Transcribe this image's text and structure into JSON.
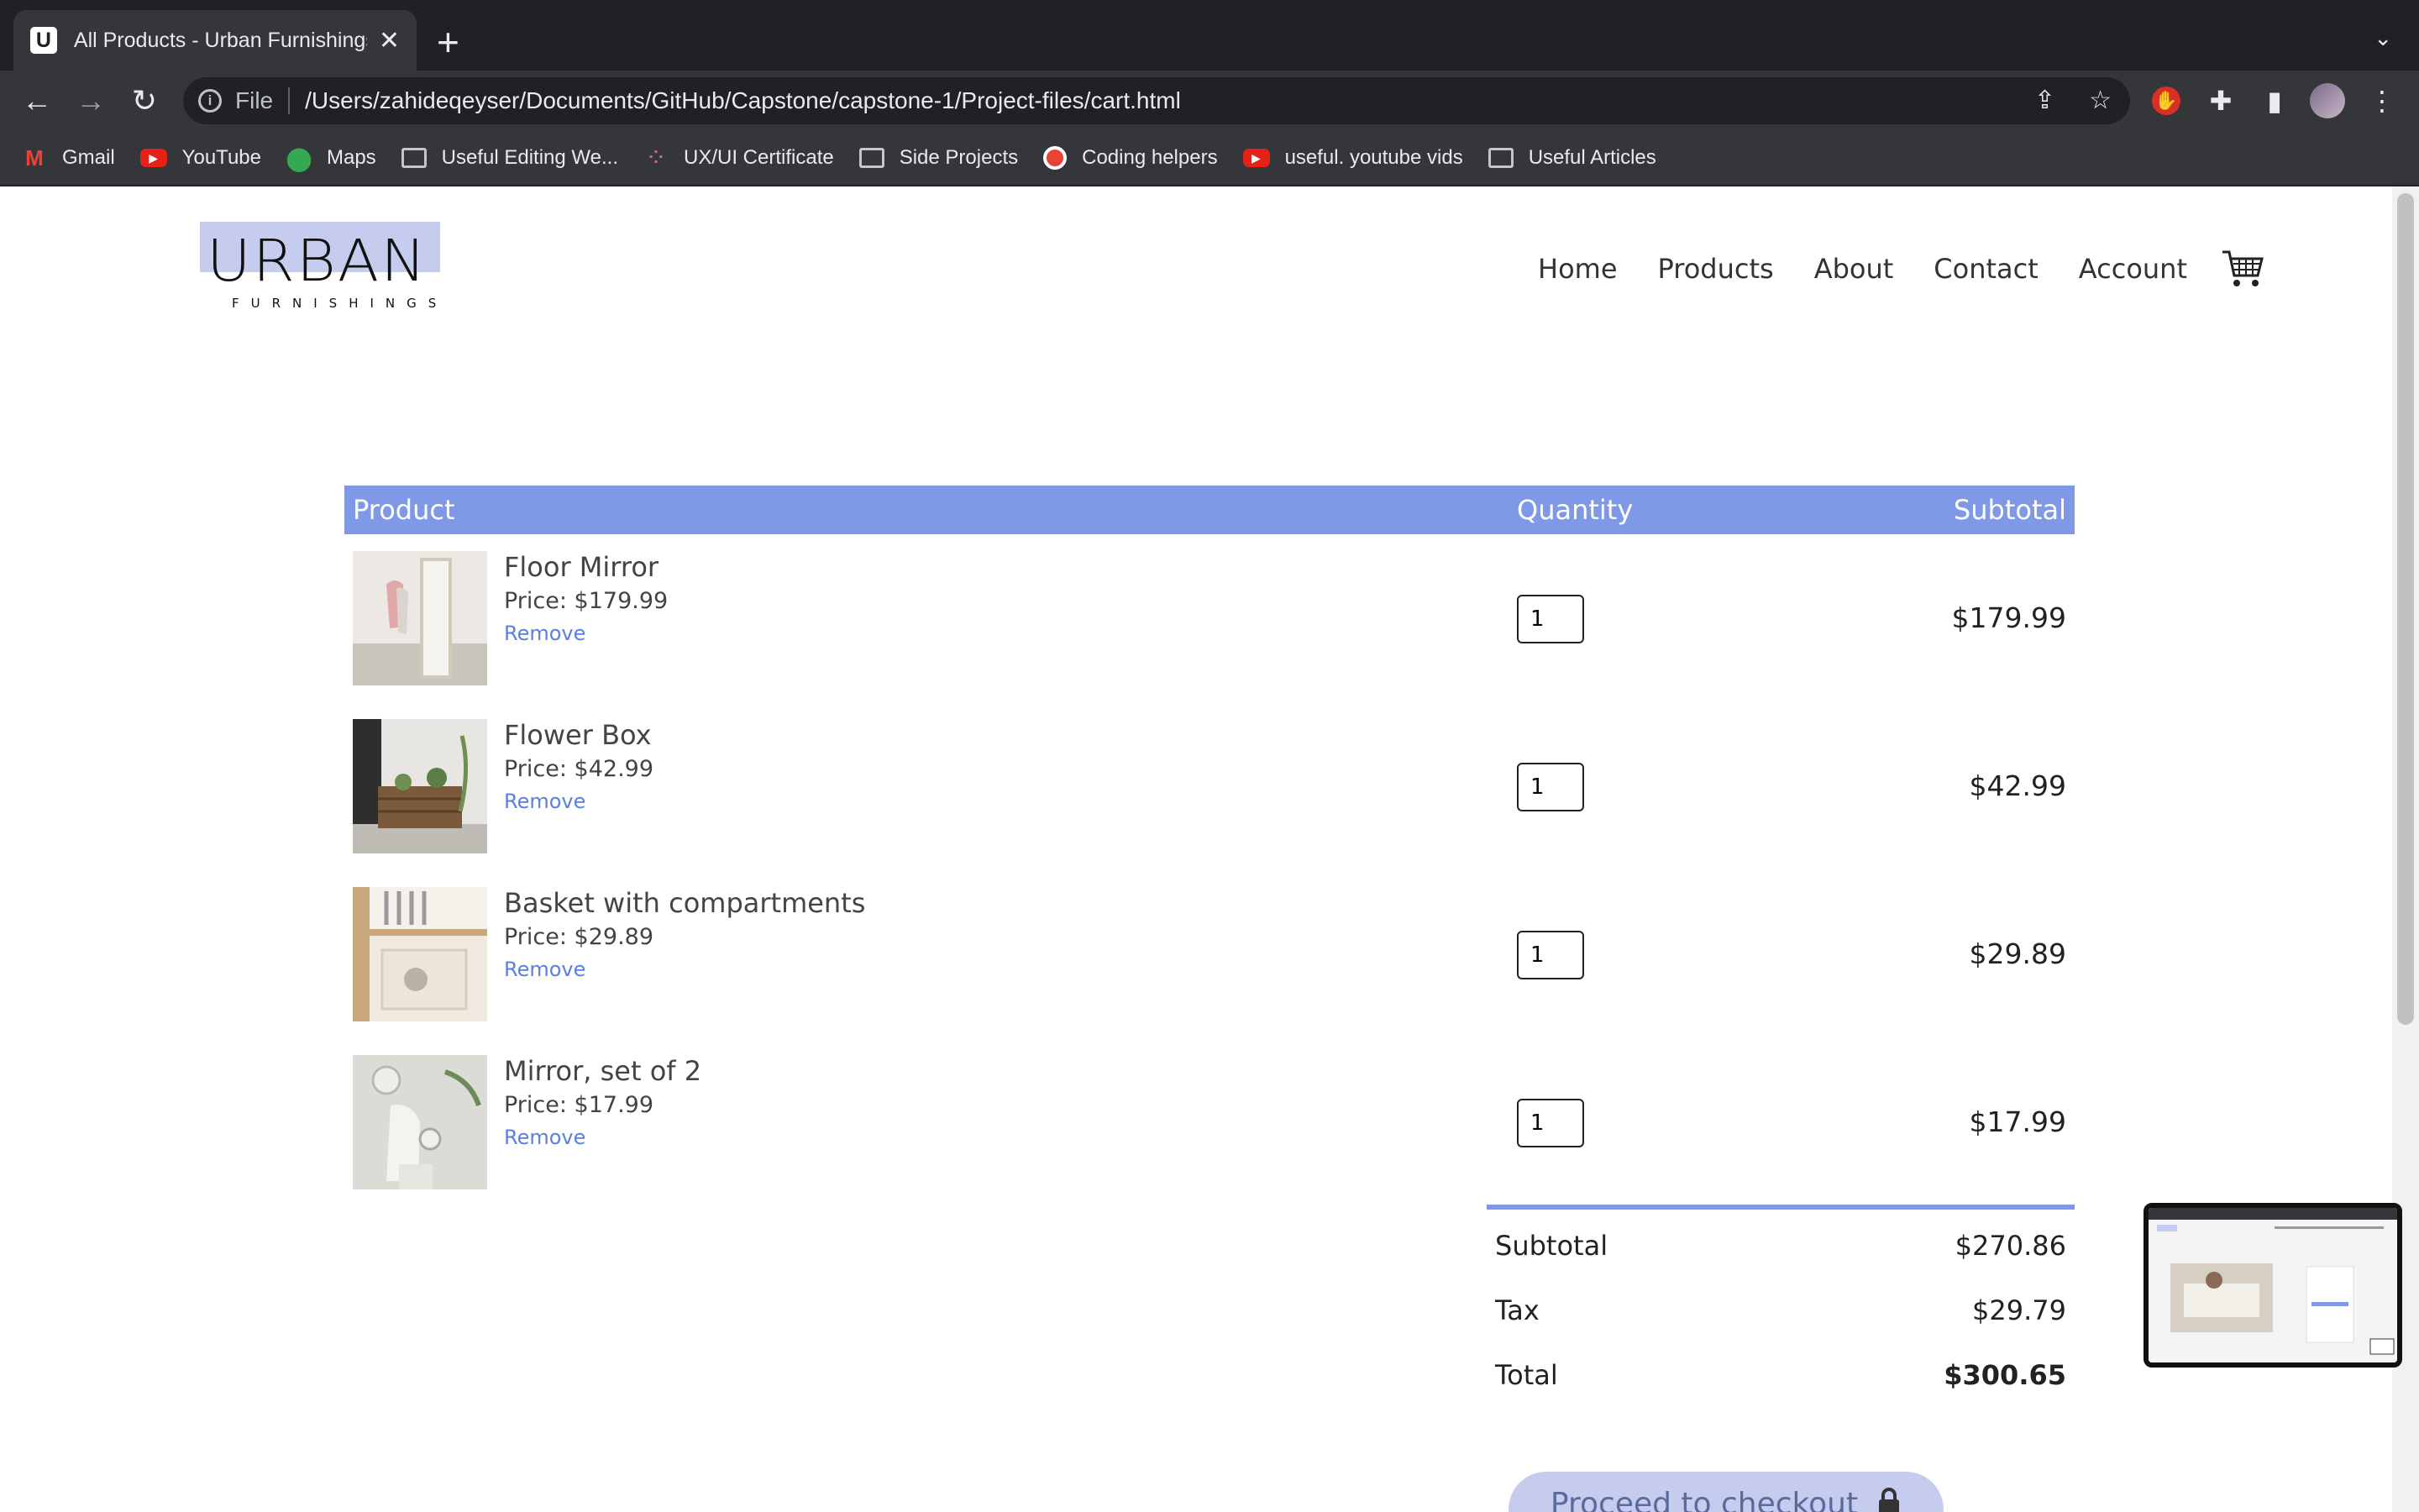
{
  "browser": {
    "tab_title": "All Products - Urban Furnishings",
    "tab_favicon": "U",
    "url_scheme": "File",
    "url": "/Users/zahideqeyser/Documents/GitHub/Capstone/capstone-1/Project-files/cart.html",
    "bookmarks": [
      {
        "label": "Gmail",
        "icon": "gmail-icon"
      },
      {
        "label": "YouTube",
        "icon": "youtube-icon"
      },
      {
        "label": "Maps",
        "icon": "maps-icon"
      },
      {
        "label": "Useful Editing We...",
        "icon": "folder-icon"
      },
      {
        "label": "UX/UI Certificate",
        "icon": "dots-icon"
      },
      {
        "label": "Side Projects",
        "icon": "folder-icon"
      },
      {
        "label": "Coding helpers",
        "icon": "record-icon"
      },
      {
        "label": "useful. youtube vids",
        "icon": "youtube-icon"
      },
      {
        "label": "Useful Articles",
        "icon": "folder-icon"
      }
    ]
  },
  "site": {
    "logo_word": "URBAN",
    "logo_sub": "FURNISHINGS",
    "nav": [
      "Home",
      "Products",
      "About",
      "Contact",
      "Account"
    ]
  },
  "cart": {
    "headers": {
      "product": "Product",
      "quantity": "Quantity",
      "subtotal": "Subtotal"
    },
    "items": [
      {
        "name": "Floor Mirror",
        "price": "Price: $179.99",
        "remove": "Remove",
        "qty": "1",
        "subtotal": "$179.99"
      },
      {
        "name": "Flower Box",
        "price": "Price: $42.99",
        "remove": "Remove",
        "qty": "1",
        "subtotal": "$42.99"
      },
      {
        "name": "Basket with compartments",
        "price": "Price: $29.89",
        "remove": "Remove",
        "qty": "1",
        "subtotal": "$29.89"
      },
      {
        "name": "Mirror, set of 2",
        "price": "Price: $17.99",
        "remove": "Remove",
        "qty": "1",
        "subtotal": "$17.99"
      }
    ],
    "totals": {
      "subtotal_label": "Subtotal",
      "subtotal": "$270.86",
      "tax_label": "Tax",
      "tax": "$29.79",
      "total_label": "Total",
      "total": "$300.65"
    },
    "checkout_label": "Proceed to checkout"
  },
  "colors": {
    "accent": "#8099e6",
    "accent_light": "#c5ccee",
    "link": "#5a7fe0"
  }
}
